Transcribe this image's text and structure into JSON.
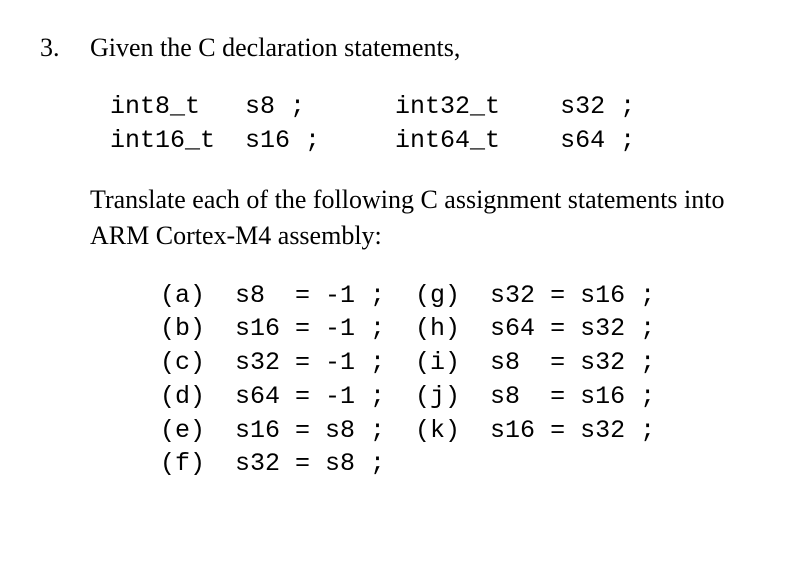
{
  "question": {
    "number": "3.",
    "prompt": "Given the C declaration statements,"
  },
  "declarations": "int8_t   s8 ;      int32_t    s32 ;\nint16_t  s16 ;     int64_t    s64 ;",
  "instruction": "Translate each of the following C assignment statements into ARM Cortex-M4 assembly:",
  "subparts": "(a)  s8  = -1 ;  (g)  s32 = s16 ;\n(b)  s16 = -1 ;  (h)  s64 = s32 ;\n(c)  s32 = -1 ;  (i)  s8  = s32 ;\n(d)  s64 = -1 ;  (j)  s8  = s16 ;\n(e)  s16 = s8 ;  (k)  s16 = s32 ;\n(f)  s32 = s8 ;"
}
